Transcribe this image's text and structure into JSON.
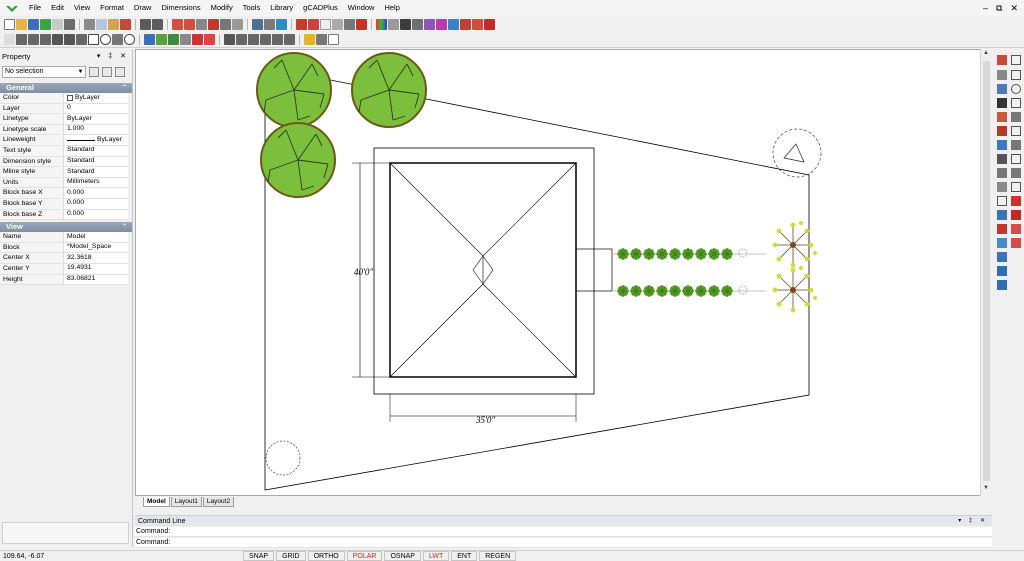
{
  "menu": [
    "File",
    "Edit",
    "View",
    "Format",
    "Draw",
    "Dimensions",
    "Modify",
    "Tools",
    "Library",
    "gCADPlus",
    "Window",
    "Help"
  ],
  "window_controls": {
    "minimize": "–",
    "restore": "⧉",
    "close": "✕"
  },
  "property_panel": {
    "title": "Property",
    "header_buttons": "▾ ‡ ✕",
    "selection": "No selection",
    "general": {
      "title": "General",
      "rows": [
        {
          "key": "Color",
          "value": "ByLayer"
        },
        {
          "key": "Layer",
          "value": "0"
        },
        {
          "key": "Linetype",
          "value": "ByLayer"
        },
        {
          "key": "Linetype scale",
          "value": "1.000"
        },
        {
          "key": "Lineweight",
          "value": "ByLayer"
        },
        {
          "key": "Text style",
          "value": "Standard"
        },
        {
          "key": "Dimension style",
          "value": "Standard"
        },
        {
          "key": "Mline style",
          "value": "Standard"
        },
        {
          "key": "Units",
          "value": "Millimeters"
        },
        {
          "key": "Block base X",
          "value": "0.000"
        },
        {
          "key": "Block base Y",
          "value": "0.000"
        },
        {
          "key": "Block base Z",
          "value": "0.000"
        }
      ]
    },
    "view": {
      "title": "View",
      "rows": [
        {
          "key": "Name",
          "value": "Model"
        },
        {
          "key": "Block",
          "value": "*Model_Space"
        },
        {
          "key": "Center X",
          "value": "32.3618"
        },
        {
          "key": "Center Y",
          "value": "19.4931"
        },
        {
          "key": "Height",
          "value": "83.06821"
        }
      ]
    }
  },
  "drawing": {
    "dim_vertical": "40'0\"",
    "dim_horizontal": "35'0\""
  },
  "tabs": [
    "Model",
    "Layout1",
    "Layout2"
  ],
  "command_line": {
    "title": "Command Line",
    "header_buttons": "▾ ‡ ✕",
    "lines": [
      "Command:",
      "Command:"
    ]
  },
  "status": {
    "coords": "109.64,  -6.07",
    "buttons": [
      {
        "label": "SNAP",
        "on": false
      },
      {
        "label": "GRID",
        "on": false
      },
      {
        "label": "ORTHO",
        "on": false
      },
      {
        "label": "POLAR",
        "on": true
      },
      {
        "label": "OSNAP",
        "on": false
      },
      {
        "label": "LWT",
        "on": true
      },
      {
        "label": "ENT",
        "on": false
      },
      {
        "label": "REGEN",
        "on": false
      }
    ]
  },
  "colors": {
    "tree_fill": "#7bbf3c",
    "tree_edge": "#6a5a14",
    "hedge": "#5aa72a",
    "status_on": "#d2261d",
    "group_header": "#8897ab"
  }
}
